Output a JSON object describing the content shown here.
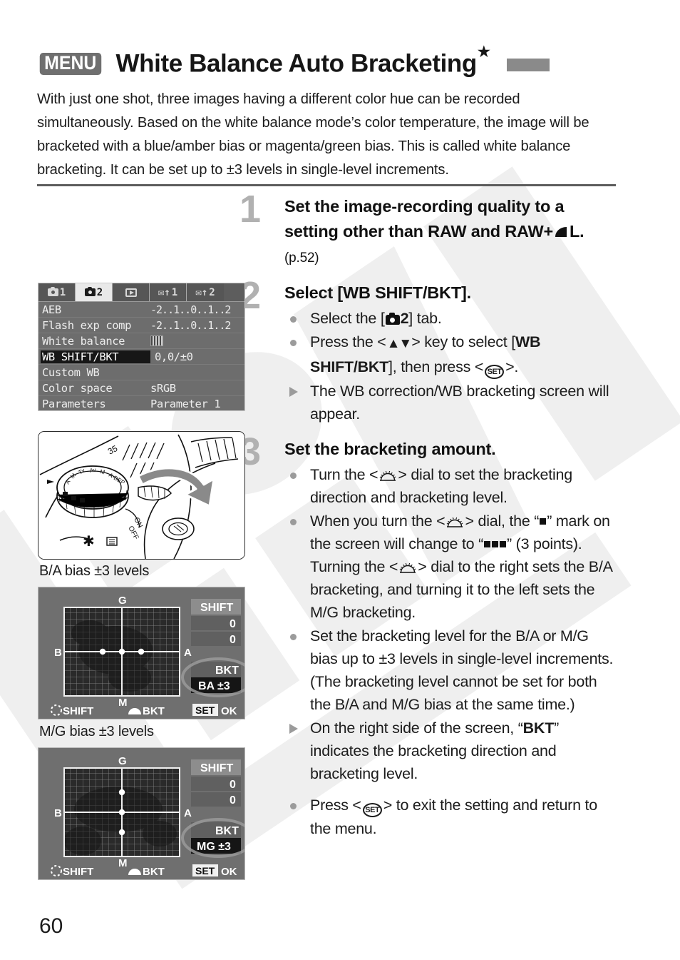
{
  "page": {
    "number": "60",
    "title": "White Balance Auto Bracketing",
    "title_badge": "MENU",
    "title_star": "★",
    "intro": "With just one shot, three images having a different color hue can be recorded simultaneously. Based on the white balance mode’s color temperature, the image will be bracketed with a blue/amber bias or magenta/green bias. This is called white balance bracketing. It can be set up to ±3 levels in single-level increments."
  },
  "steps": [
    {
      "number": "1",
      "heading_a": "Set the image-recording quality to a setting other than RAW and RAW+",
      "heading_b": "L.",
      "heading_ref": "(p.52)",
      "bullets": []
    },
    {
      "number": "2",
      "heading": "Select [WB SHIFT/BKT].",
      "bullets": [
        {
          "type": "dot",
          "parts": [
            "Select the [",
            "icon:camera2",
            "] tab."
          ]
        },
        {
          "type": "dot",
          "parts": [
            "Press the <",
            "icon:updown",
            "> key to select [",
            "b:WB SHIFT/BKT",
            "], then press <",
            "icon:set",
            ">."
          ]
        },
        {
          "type": "tri",
          "parts": [
            "The WB correction/WB bracketing screen will appear."
          ]
        }
      ]
    },
    {
      "number": "3",
      "heading": "Set the bracketing amount.",
      "bullets": [
        {
          "type": "dot",
          "parts": [
            "Turn the <",
            "icon:dial",
            "> dial to set the bracketing direction and bracketing level."
          ]
        },
        {
          "type": "dot",
          "parts": [
            "When you turn the <",
            "icon:dial",
            "> dial, the “",
            "icon:square",
            "” mark on the screen will change to “",
            "icon:square3",
            "” (3 points). Turning the <",
            "icon:dial",
            "> dial to the right sets the B/A bracketing, and turning it to the left sets the M/G bracketing."
          ]
        },
        {
          "type": "dot",
          "parts": [
            "Set the bracketing level for the B/A or M/G bias up to ±3 levels in single-level increments. (The bracketing level cannot be set for both the B/A and M/G bias at the same time.)"
          ]
        },
        {
          "type": "tri",
          "parts": [
            "On the right side of the screen, “",
            "b:BKT",
            "” indicates the bracketing direction and bracketing level."
          ]
        },
        {
          "type": "dot",
          "parts": [
            "Press <",
            "icon:set",
            "> to exit the setting and return to the menu."
          ]
        }
      ]
    }
  ],
  "menu_screen": {
    "tabs": [
      {
        "icon": "camera-icon",
        "label": "1",
        "selected": false
      },
      {
        "icon": "camera-icon",
        "label": "2",
        "selected": true
      },
      {
        "icon": "playback-icon",
        "label": "",
        "selected": false
      },
      {
        "icon": "wrench-icon",
        "label": "1",
        "selected": false
      },
      {
        "icon": "wrench-icon",
        "label": "2",
        "selected": false
      }
    ],
    "rows": [
      {
        "label": "AEB",
        "value": "-2..1..0..1..2",
        "type": "scale",
        "highlight": false
      },
      {
        "label": "Flash exp comp",
        "value": "-2..1..0..1..2",
        "type": "scale",
        "highlight": false
      },
      {
        "label": "White balance",
        "value": "",
        "type": "wb-icon",
        "highlight": false
      },
      {
        "label": "WB SHIFT/BKT",
        "value": "0,0/±0",
        "type": "text",
        "highlight": true
      },
      {
        "label": "Custom WB",
        "value": "",
        "type": "text",
        "highlight": false
      },
      {
        "label": "Color space",
        "value": "sRGB",
        "type": "text",
        "highlight": false
      },
      {
        "label": "Parameters",
        "value": "Parameter 1",
        "type": "text",
        "highlight": false
      }
    ]
  },
  "figures": {
    "dial_photo_caption": "B/A bias ±3 levels",
    "mg_caption": "M/G bias ±3 levels"
  },
  "lcd_ba": {
    "axis_top": "G",
    "axis_bottom": "M",
    "axis_left": "B",
    "axis_right": "A",
    "shift_label": "SHIFT",
    "shift_value_1": "0",
    "shift_value_2": "0",
    "bkt_label": "BKT",
    "bkt_value": "BA ±3",
    "footer_shift": "SHIFT",
    "footer_bkt": "BKT",
    "footer_set": "SET",
    "footer_ok": "OK",
    "points": "horizontal"
  },
  "lcd_mg": {
    "axis_top": "G",
    "axis_bottom": "M",
    "axis_left": "B",
    "axis_right": "A",
    "shift_label": "SHIFT",
    "shift_value_1": "0",
    "shift_value_2": "0",
    "bkt_label": "BKT",
    "bkt_value": "MG ±3",
    "footer_shift": "SHIFT",
    "footer_bkt": "BKT",
    "footer_set": "SET",
    "footer_ok": "OK",
    "points": "vertical"
  },
  "colors": {
    "accent_gray": "#8a8a8a",
    "step_num": "#b1b1b1",
    "lcd_bg": "#6f6f6f",
    "highlight": "#171717"
  }
}
